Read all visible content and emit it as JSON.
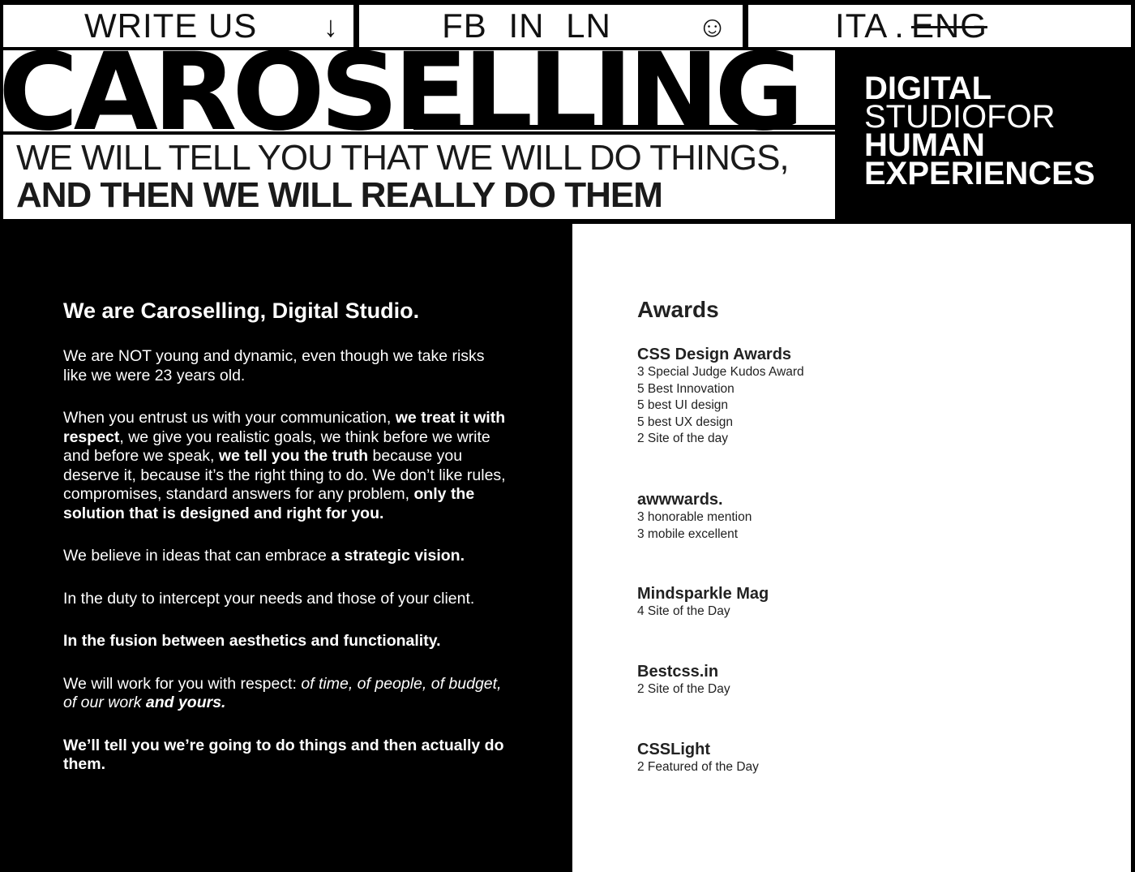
{
  "nav": {
    "write_label": "WRITE US",
    "write_arrow": "↓",
    "social_label": "FB IN LN",
    "smile": "☺",
    "lang_ita": "ITA",
    "lang_sep": ".",
    "lang_eng": "ENG"
  },
  "header": {
    "logo": "CAROSELLING",
    "tagline_line1": "WE WILL TELL YOU THAT WE WILL DO THINGS,",
    "tagline_line2": "AND THEN WE WILL REALLY DO THEM",
    "studio_line1": "DIGITAL",
    "studio_line2": "STUDIOFOR",
    "studio_line3": "HUMAN",
    "studio_line4": "EXPERIENCES"
  },
  "about": {
    "title": "We are Caroselling, Digital Studio.",
    "p1": "We are NOT young and dynamic, even though we take risks like we were 23 years old.",
    "p2_a": "When you entrust us with your communication, ",
    "p2_b": "we treat it with respect",
    "p2_c": ", we give you realistic goals, we think before we write and before we speak, ",
    "p2_d": "we tell you the truth",
    "p2_e": " because you deserve it, because it’s the right thing to do. We don’t like rules, compromises, standard answers for any problem, ",
    "p2_f": "only the solution that is designed and right for you.",
    "p3_a": "We believe in ideas that can embrace ",
    "p3_b": "a strategic vision.",
    "p4": "In the duty to intercept your needs and those of your client.",
    "p5": "In the fusion between aesthetics and functionality.",
    "p6_a": "We will work for you with respect: ",
    "p6_b": "of time, of people, of budget, of our work ",
    "p6_c": "and yours.",
    "p7": "We’ll tell you we’re going to do things and then actually do them."
  },
  "awards": {
    "title": "Awards",
    "groups": [
      {
        "name": "CSS Design Awards",
        "items": [
          "3 Special Judge Kudos Award",
          "5 Best Innovation",
          "5 best UI design",
          "5 best UX design",
          "2 Site of the day"
        ]
      },
      {
        "name": "awwwards.",
        "items": [
          "3 honorable mention",
          "3 mobile excellent"
        ]
      },
      {
        "name": "Mindsparkle Mag",
        "items": [
          "4 Site of the Day"
        ]
      },
      {
        "name": "Bestcss.in",
        "items": [
          "2 Site of the Day"
        ]
      },
      {
        "name": "CSSLight",
        "items": [
          "2 Featured of the Day"
        ]
      }
    ]
  }
}
